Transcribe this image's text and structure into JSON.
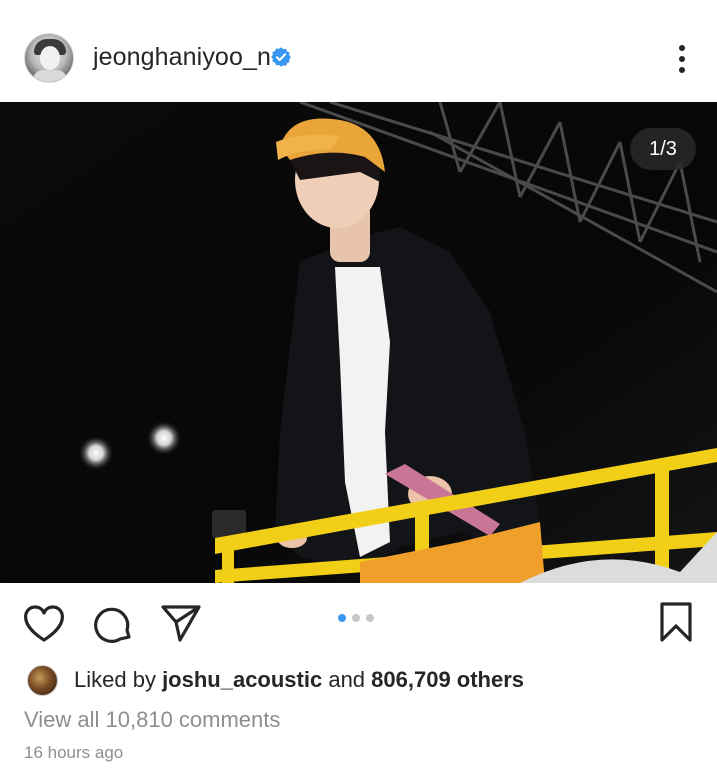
{
  "header": {
    "username": "jeonghaniyoo_n",
    "verified": true,
    "avatar_icon": "profile-avatar",
    "more_icon": "more-vertical-icon"
  },
  "post": {
    "image_counter": "1/3",
    "image_description_icon": "concert-photo",
    "carousel": {
      "total": 3,
      "active_index": 1
    }
  },
  "actions": {
    "like_icon": "heart-icon",
    "comment_icon": "comment-icon",
    "share_icon": "send-icon",
    "save_icon": "bookmark-icon"
  },
  "likes": {
    "prefix": "Liked by ",
    "liker": "joshu_acoustic",
    "middle": " and ",
    "others": "806,709 others"
  },
  "comments": {
    "view_all": "View all 10,810 comments"
  },
  "timestamp": "16 hours ago",
  "colors": {
    "text": "#262626",
    "muted": "#8e8e8e",
    "verified_blue": "#3897f0",
    "carousel_active": "#3b96f0",
    "railing_yellow": "#f2cf17",
    "cap_orange": "#e9a53a"
  }
}
